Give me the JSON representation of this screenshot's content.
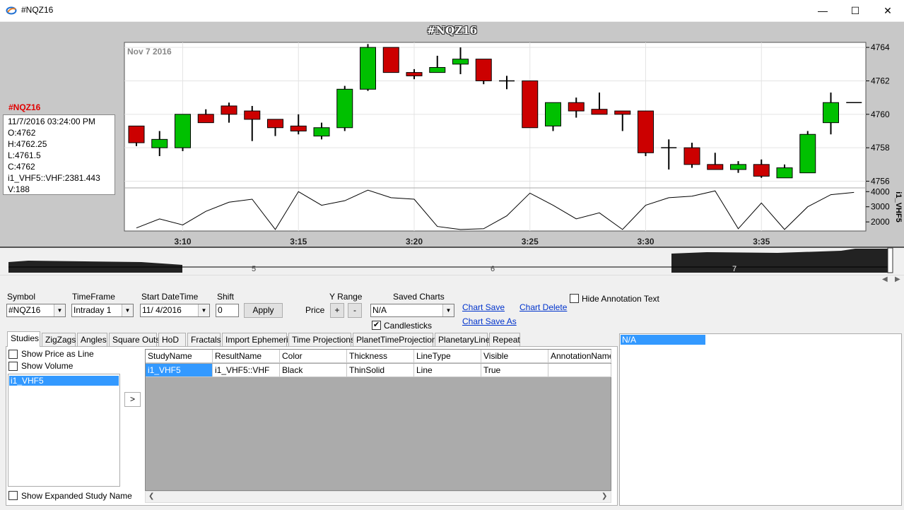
{
  "window": {
    "title": "#NQZ16",
    "minimize_glyph": "—",
    "maximize_glyph": "☐",
    "close_glyph": "✕"
  },
  "chart": {
    "title": "#NQZ16",
    "date_label": "Nov 7 2016",
    "info": {
      "symbol": "#NQZ16",
      "lines": [
        "11/7/2016 03:24:00 PM",
        "O:4762",
        "H:4762.25",
        "L:4761.5",
        "C:4762",
        "i1_VHF5::VHF:2381.443",
        "V:188"
      ]
    },
    "sub_axis_label": "i1_VHF5",
    "overview_labels": [
      "5",
      "6",
      "7"
    ],
    "colors": {
      "up": "#00c000",
      "down": "#cc0000",
      "frame": "#c8c8c8"
    }
  },
  "chart_data": {
    "type": "candlestick",
    "title": "#NQZ16",
    "x": [
      "3:08",
      "3:09",
      "3:10",
      "3:11",
      "3:12",
      "3:13",
      "3:14",
      "3:15",
      "3:16",
      "3:17",
      "3:18",
      "3:19",
      "3:20",
      "3:21",
      "3:22",
      "3:23",
      "3:24",
      "3:25",
      "3:26",
      "3:27",
      "3:28",
      "3:29",
      "3:30",
      "3:31",
      "3:32",
      "3:33",
      "3:34",
      "3:35",
      "3:36",
      "3:37",
      "3:38",
      "3:39"
    ],
    "x_ticks": [
      "3:10",
      "3:15",
      "3:20",
      "3:25",
      "3:30",
      "3:35"
    ],
    "y_ticks": [
      "4764",
      "4762",
      "4760",
      "4758",
      "4756"
    ],
    "ylim": [
      4755.6,
      4764.3
    ],
    "ohlc": [
      [
        4759.3,
        4759.3,
        4758.1,
        4758.3
      ],
      [
        4758.0,
        4759.0,
        4757.5,
        4758.5
      ],
      [
        4758.0,
        4760.0,
        4757.8,
        4760.0
      ],
      [
        4760.0,
        4760.3,
        4759.5,
        4759.5
      ],
      [
        4760.5,
        4760.7,
        4759.5,
        4760.0
      ],
      [
        4760.2,
        4760.5,
        4758.4,
        4759.7
      ],
      [
        4759.7,
        4759.7,
        4758.7,
        4759.2
      ],
      [
        4759.3,
        4760.0,
        4758.8,
        4759.0
      ],
      [
        4758.7,
        4759.5,
        4758.5,
        4759.2
      ],
      [
        4759.2,
        4761.7,
        4759.0,
        4761.5
      ],
      [
        4761.5,
        4764.2,
        4761.4,
        4764.0
      ],
      [
        4764.0,
        4764.0,
        4762.5,
        4762.5
      ],
      [
        4762.5,
        4762.7,
        4762.1,
        4762.3
      ],
      [
        4762.5,
        4763.5,
        4762.5,
        4762.8
      ],
      [
        4763.0,
        4764.0,
        4762.4,
        4763.3
      ],
      [
        4763.3,
        4763.3,
        4761.8,
        4762.0
      ],
      [
        4762.0,
        4762.3,
        4761.5,
        4762.0
      ],
      [
        4762.0,
        4762.0,
        4759.2,
        4759.2
      ],
      [
        4759.3,
        4760.7,
        4759.0,
        4760.7
      ],
      [
        4760.7,
        4761.0,
        4759.8,
        4760.2
      ],
      [
        4760.3,
        4761.3,
        4760.0,
        4760.0
      ],
      [
        4760.2,
        4760.2,
        4759.0,
        4760.0
      ],
      [
        4760.2,
        4760.2,
        4757.5,
        4757.7
      ],
      [
        4758.0,
        4758.5,
        4756.7,
        4758.0
      ],
      [
        4758.0,
        4758.3,
        4756.8,
        4757.0
      ],
      [
        4757.0,
        4757.7,
        4756.7,
        4756.7
      ],
      [
        4756.7,
        4757.2,
        4756.5,
        4757.0
      ],
      [
        4757.0,
        4757.3,
        4756.2,
        4756.3
      ],
      [
        4756.2,
        4757.0,
        4756.2,
        4756.8
      ],
      [
        4756.5,
        4759.0,
        4756.5,
        4758.8
      ],
      [
        4759.5,
        4761.3,
        4758.8,
        4760.7
      ],
      [
        4760.7,
        4760.7,
        4760.7,
        4760.7
      ]
    ],
    "sub_series": {
      "name": "i1_VHF5",
      "y_ticks": [
        "4000",
        "3000",
        "2000"
      ],
      "ylim": [
        1400,
        4200
      ],
      "values": [
        1600,
        2200,
        1800,
        2700,
        3300,
        3500,
        1500,
        4000,
        3100,
        3400,
        4100,
        3600,
        3500,
        1700,
        1500,
        1550,
        2400,
        3900,
        3100,
        2200,
        2600,
        1500,
        3100,
        3600,
        3700,
        4050,
        1550,
        3250,
        1500,
        3000,
        3800,
        3950
      ]
    }
  },
  "controls": {
    "symbol_label": "Symbol",
    "symbol_value": "#NQZ16",
    "timeframe_label": "TimeFrame",
    "timeframe_value": "Intraday 1",
    "start_label": "Start DateTime",
    "start_value": "11/  4/2016",
    "shift_label": "Shift",
    "shift_value": "0",
    "apply_label": "Apply",
    "yrange_label": "Y Range",
    "price_label": "Price",
    "plus_label": "+",
    "minus_label": "-",
    "saved_charts_label": "Saved Charts",
    "saved_charts_value": "N/A",
    "candlesticks_label": "Candlesticks",
    "chart_save": "Chart Save",
    "chart_save_as": "Chart Save As",
    "chart_delete": "Chart Delete",
    "hide_annotation": "Hide Annotation Text"
  },
  "tabs": [
    "Studies",
    "ZigZags",
    "Angles",
    "Square Outs",
    "HoD",
    "Fractals",
    "Import Ephemeris",
    "Time Projections",
    "PlanetTimeProjections",
    "PlanetaryLines",
    "Repeat"
  ],
  "studies": {
    "show_price_as_line": "Show Price as Line",
    "show_volume": "Show Volume",
    "list": [
      "i1_VHF5"
    ],
    "move_button": ">",
    "show_expanded": "Show Expanded Study Name",
    "columns": [
      "StudyName",
      "ResultName",
      "Color",
      "Thickness",
      "LineType",
      "Visible",
      "AnnotationName"
    ],
    "rows": [
      [
        "i1_VHF5",
        "i1_VHF5::VHF",
        "Black",
        "ThinSolid",
        "Line",
        "True",
        ""
      ]
    ]
  },
  "right_list": [
    "N/A"
  ]
}
